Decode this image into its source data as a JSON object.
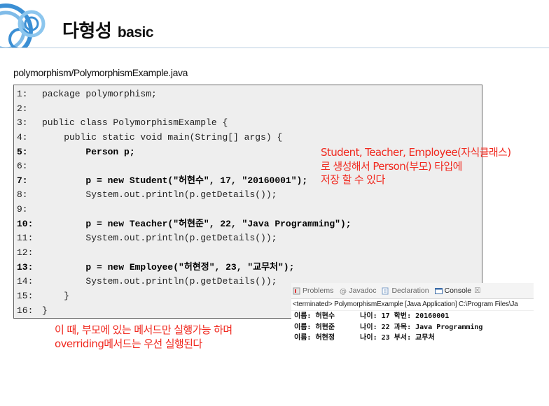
{
  "header": {
    "title_ko": "다형성",
    "title_en": "basic"
  },
  "file_path": "polymorphism/PolymorphismExample.java",
  "code_lines": [
    {
      "num": "1:",
      "text": "package polymorphism;",
      "bold": false
    },
    {
      "num": "2:",
      "text": "",
      "bold": false
    },
    {
      "num": "3:",
      "text": "public class PolymorphismExample {",
      "bold": false
    },
    {
      "num": "4:",
      "text": "    public static void main(String[] args) {",
      "bold": false
    },
    {
      "num": "5:",
      "text": "        Person p;",
      "bold": true
    },
    {
      "num": "6:",
      "text": "",
      "bold": false
    },
    {
      "num": "7:",
      "text": "        p = new Student(\"허현수\", 17, \"20160001\");",
      "bold": true
    },
    {
      "num": "8:",
      "text": "        System.out.println(p.getDetails());",
      "bold": false
    },
    {
      "num": "9:",
      "text": "",
      "bold": false
    },
    {
      "num": "10:",
      "text": "        p = new Teacher(\"허현준\", 22, \"Java Programming\");",
      "bold": true
    },
    {
      "num": "11:",
      "text": "        System.out.println(p.getDetails());",
      "bold": false
    },
    {
      "num": "12:",
      "text": "",
      "bold": false
    },
    {
      "num": "13:",
      "text": "        p = new Employee(\"허현정\", 23, \"교무처\");",
      "bold": true
    },
    {
      "num": "14:",
      "text": "        System.out.println(p.getDetails());",
      "bold": false
    },
    {
      "num": "15:",
      "text": "    }",
      "bold": false
    },
    {
      "num": "16:",
      "text": "}",
      "bold": false
    }
  ],
  "notes": {
    "right": [
      "Student, Teacher, Employee(자식클래스)",
      "로 생성해서 Person(부모) 타입에",
      "저장 할 수 있다"
    ],
    "bottom": [
      "이 때, 부모에 있는 메서드만 실행가능 하며",
      "overriding메서드는 우선 실행된다"
    ]
  },
  "console": {
    "tabs": [
      {
        "label": "Problems",
        "icon": "problems-icon",
        "active": false
      },
      {
        "label": "Javadoc",
        "icon": "javadoc-icon",
        "active": false
      },
      {
        "label": "Declaration",
        "icon": "declaration-icon",
        "active": false
      },
      {
        "label": "Console",
        "icon": "console-icon",
        "active": true
      }
    ],
    "close_glyph": "☒",
    "terminated": "<terminated> PolymorphismExample [Java Application] C:\\Program Files\\Ja",
    "output": [
      "이름: 허현수      나이: 17 학번: 20160001",
      "이름: 허현준      나이: 22 과목: Java Programming",
      "이름: 허현정      나이: 23 부서: 교무처"
    ]
  },
  "colors": {
    "note": "#f0281e",
    "logo": "#3b8fd4",
    "code_bg": "#eeeeee"
  }
}
